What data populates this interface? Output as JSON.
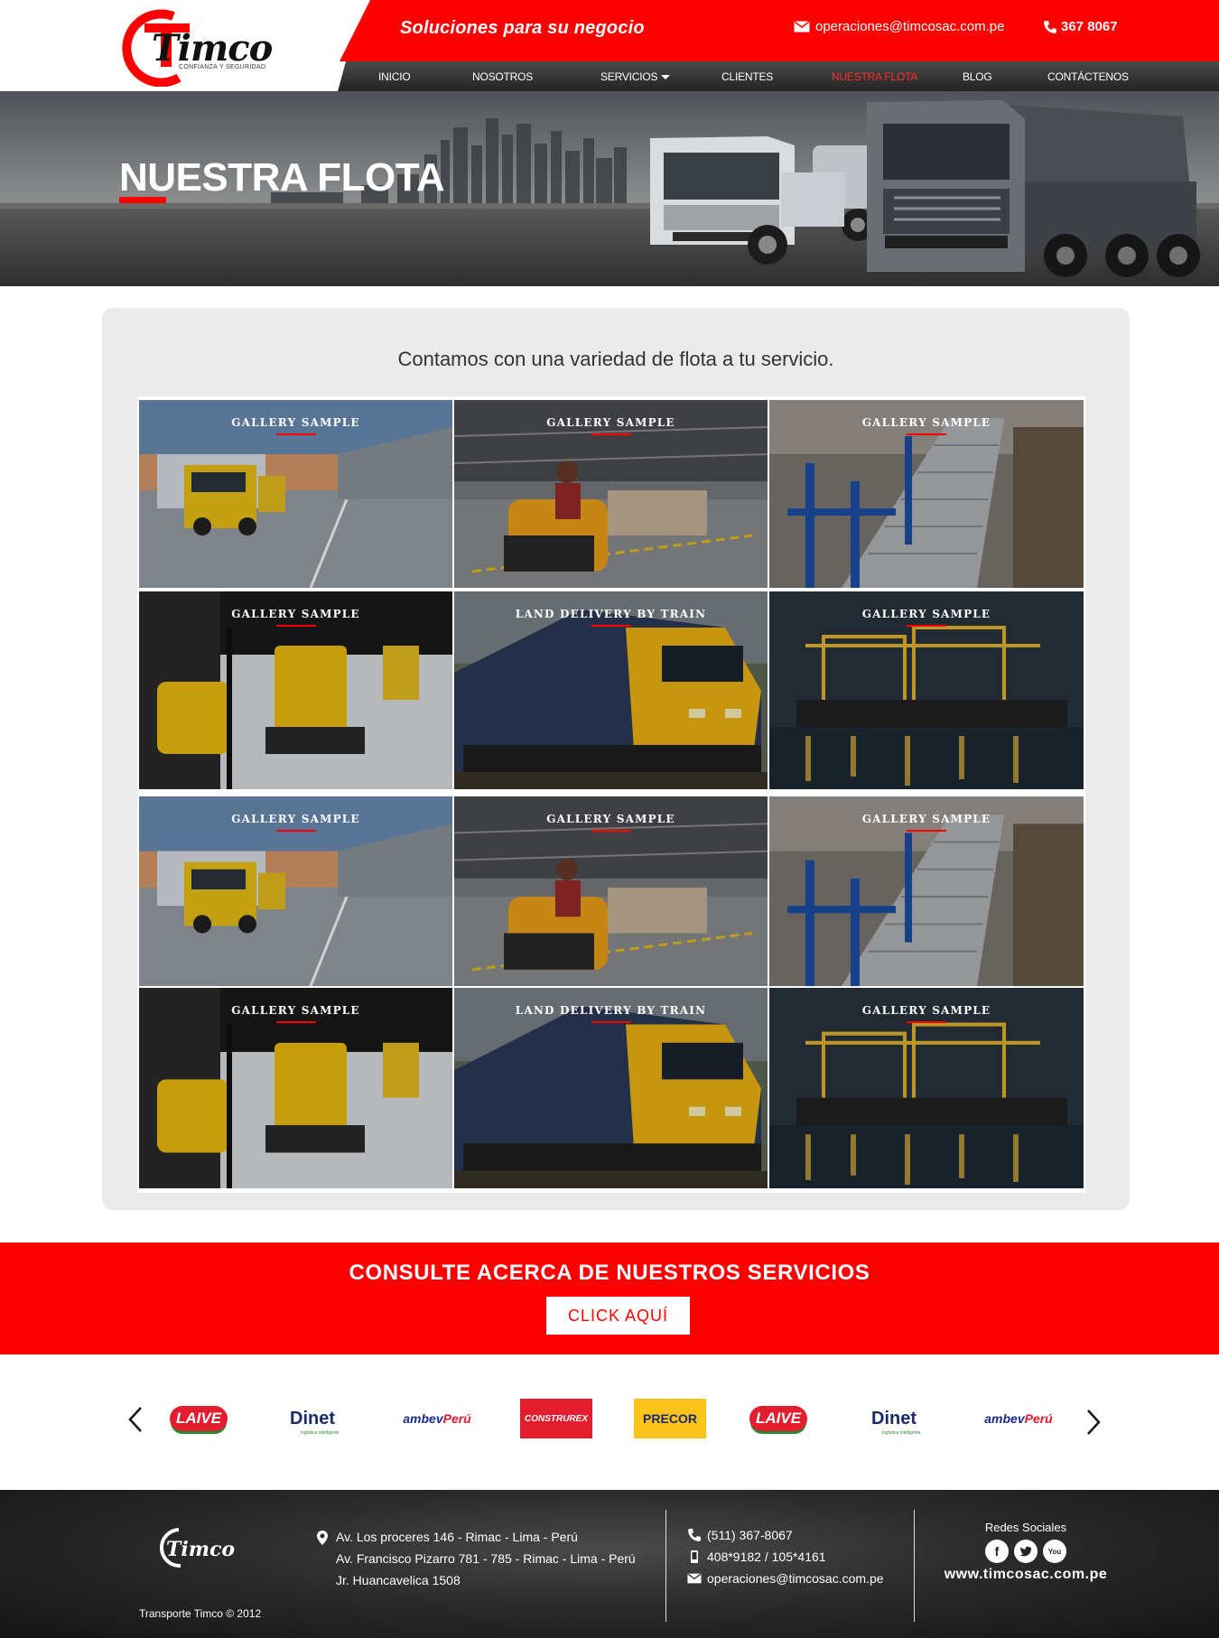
{
  "header": {
    "logo_text": "Timco",
    "logo_tagline": "CONFIANZA Y SEGURIDAD",
    "tagline": "Soluciones  para  su negocio",
    "email": "operaciones@timcosac.com.pe",
    "phone": "367 8067"
  },
  "nav": {
    "items": [
      {
        "label": "INICIO"
      },
      {
        "label": "NOSOTROS"
      },
      {
        "label": "SERVICIOS"
      },
      {
        "label": "CLIENTES"
      },
      {
        "label": "NUESTRA FLOTA"
      },
      {
        "label": "BLOG"
      },
      {
        "label": "CONTÁCTENOS"
      }
    ],
    "active": "NUESTRA FLOTA"
  },
  "hero": {
    "title": "NUESTRA FLOTA"
  },
  "gallery": {
    "intro": "Contamos con una variedad de flota a tu servicio.",
    "tiles": [
      {
        "label": "GALLERY SAMPLE",
        "scene": "truck-yard"
      },
      {
        "label": "GALLERY SAMPLE",
        "scene": "warehouse-tug"
      },
      {
        "label": "GALLERY SAMPLE",
        "scene": "conveyor"
      },
      {
        "label": "GALLERY SAMPLE",
        "scene": "pallet-jack"
      },
      {
        "label": "LAND DELIVERY BY TRAIN",
        "scene": "train"
      },
      {
        "label": "GALLERY SAMPLE",
        "scene": "port-cranes"
      },
      {
        "label": "GALLERY SAMPLE",
        "scene": "truck-yard"
      },
      {
        "label": "GALLERY SAMPLE",
        "scene": "warehouse-tug"
      },
      {
        "label": "GALLERY SAMPLE",
        "scene": "conveyor"
      },
      {
        "label": "GALLERY SAMPLE",
        "scene": "pallet-jack"
      },
      {
        "label": "LAND DELIVERY BY TRAIN",
        "scene": "train"
      },
      {
        "label": "GALLERY SAMPLE",
        "scene": "port-cranes"
      }
    ]
  },
  "cta": {
    "title": "CONSULTE ACERCA DE NUESTROS SERVICIOS",
    "button": "CLICK AQUÍ"
  },
  "clients": {
    "laive": "LAIVE",
    "dinet": "Dinet",
    "dinet_tag": "logística inteligente",
    "ambev_a": "ambev",
    "ambev_b": "Perú",
    "construrex": "CONSTRUREX",
    "precor": "PRECOR"
  },
  "footer": {
    "address_lines": [
      "Av. Los proceres 146 - Rimac - Lima - Perú",
      "Av. Francisco Pizarro 781 - 785 - Rimac - Lima - Perú",
      "Jr. Huancavelica 1508"
    ],
    "phone": "(511) 367-8067",
    "mobile": "408*9182 / 105*4161",
    "email": "operaciones@timcosac.com.pe",
    "social_title": "Redes Sociales",
    "social_url": "www.timcosac.com.pe",
    "copyright": "Transporte Timco © 2012"
  },
  "colors": {
    "brand_red": "#ff0000",
    "nav_dark": "#2a2a2a",
    "panel_bg": "#ebebeb"
  }
}
